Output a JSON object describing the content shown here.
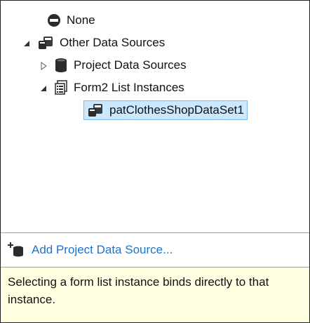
{
  "tree": {
    "items": [
      {
        "label": "None",
        "icon": "none-circle-icon"
      },
      {
        "label": "Other Data Sources",
        "icon": "data-sources-icon",
        "expanded": true
      },
      {
        "label": "Project Data Sources",
        "icon": "database-icon",
        "expanded": false
      },
      {
        "label": "Form2 List Instances",
        "icon": "form-list-icon",
        "expanded": true
      },
      {
        "label": "patClothesShopDataSet1",
        "icon": "dataset-icon",
        "selected": true
      }
    ]
  },
  "footer": {
    "add_label": "Add Project Data Source..."
  },
  "help": {
    "text": "Selecting a form list instance binds directly to that instance."
  },
  "colors": {
    "link": "#1e73c9",
    "selection": "#cce8ff",
    "help_background": "#ffffe1"
  }
}
